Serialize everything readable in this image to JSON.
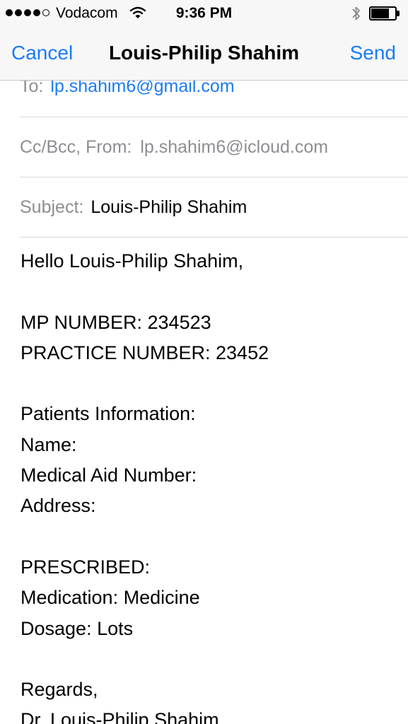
{
  "status_bar": {
    "carrier": "Vodacom",
    "time": "9:36 PM",
    "signal_bars_filled": 4,
    "signal_bars_total": 5,
    "battery_level": 0.75,
    "icons": [
      "wifi-icon",
      "bluetooth-icon",
      "battery-icon"
    ]
  },
  "nav": {
    "cancel_label": "Cancel",
    "title": "Louis-Philip Shahim",
    "send_label": "Send"
  },
  "colors": {
    "accent": "#1a7cf4",
    "label_gray": "#8e8e93",
    "bar_bg": "#f7f7f8"
  },
  "compose": {
    "to_label": "To:",
    "to_value": "lp.shahim6@gmail.com",
    "ccbcc_label": "Cc/Bcc, From:",
    "from_value": "lp.shahim6@icloud.com",
    "subject_label": "Subject:",
    "subject_value": "Louis-Philip Shahim"
  },
  "body": {
    "greeting": "Hello Louis-Philip Shahim,",
    "mp_number": "MP NUMBER: 234523",
    "practice_number": "PRACTICE NUMBER: 23452",
    "patients_heading": "Patients Information:",
    "name_label": "Name:",
    "medical_aid_label": "Medical Aid Number:",
    "address_label": "Address:",
    "prescribed_heading": "PRESCRIBED:",
    "medication": "Medication: Medicine",
    "dosage": "Dosage: Lots",
    "regards": "Regards,",
    "signature": "Dr. Louis-Philip Shahim"
  }
}
